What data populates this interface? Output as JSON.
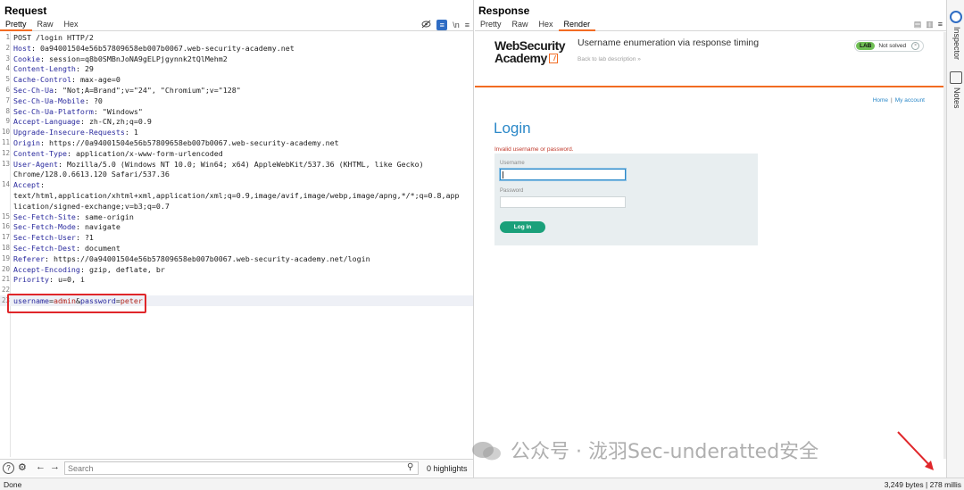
{
  "request": {
    "title": "Request",
    "tabs": [
      "Pretty",
      "Raw",
      "Hex"
    ],
    "lines": [
      {
        "n": "1",
        "k": "",
        "v": "POST /login HTTP/2"
      },
      {
        "n": "2",
        "k": "Host",
        "v": "0a94001504e56b57809658eb007b0067.web-security-academy.net"
      },
      {
        "n": "3",
        "k": "Cookie",
        "v": "session=q8b0SMBnJoNA9gELPjgynnk2tQlMehm2"
      },
      {
        "n": "4",
        "k": "Content-Length",
        "v": "29"
      },
      {
        "n": "5",
        "k": "Cache-Control",
        "v": "max-age=0"
      },
      {
        "n": "6",
        "k": "Sec-Ch-Ua",
        "v": "\"Not;A=Brand\";v=\"24\", \"Chromium\";v=\"128\""
      },
      {
        "n": "7",
        "k": "Sec-Ch-Ua-Mobile",
        "v": "?0"
      },
      {
        "n": "8",
        "k": "Sec-Ch-Ua-Platform",
        "v": "\"Windows\""
      },
      {
        "n": "9",
        "k": "Accept-Language",
        "v": "zh-CN,zh;q=0.9"
      },
      {
        "n": "10",
        "k": "Upgrade-Insecure-Requests",
        "v": "1"
      },
      {
        "n": "11",
        "k": "Origin",
        "v": "https://0a94001504e56b57809658eb007b0067.web-security-academy.net"
      },
      {
        "n": "12",
        "k": "Content-Type",
        "v": "application/x-www-form-urlencoded"
      },
      {
        "n": "13",
        "k": "User-Agent",
        "v": "Mozilla/5.0 (Windows NT 10.0; Win64; x64) AppleWebKit/537.36 (KHTML, like Gecko)"
      },
      {
        "n": "",
        "k": "",
        "v": "Chrome/128.0.6613.120 Safari/537.36"
      },
      {
        "n": "14",
        "k": "Accept",
        "v": ""
      },
      {
        "n": "",
        "k": "",
        "v": "text/html,application/xhtml+xml,application/xml;q=0.9,image/avif,image/webp,image/apng,*/*;q=0.8,app"
      },
      {
        "n": "",
        "k": "",
        "v": "lication/signed-exchange;v=b3;q=0.7"
      },
      {
        "n": "15",
        "k": "Sec-Fetch-Site",
        "v": "same-origin"
      },
      {
        "n": "16",
        "k": "Sec-Fetch-Mode",
        "v": "navigate"
      },
      {
        "n": "17",
        "k": "Sec-Fetch-User",
        "v": "?1"
      },
      {
        "n": "18",
        "k": "Sec-Fetch-Dest",
        "v": "document"
      },
      {
        "n": "19",
        "k": "Referer",
        "v": "https://0a94001504e56b57809658eb007b0067.web-security-academy.net/login"
      },
      {
        "n": "20",
        "k": "Accept-Encoding",
        "v": "gzip, deflate, br"
      },
      {
        "n": "21",
        "k": "Priority",
        "v": "u=0, i"
      },
      {
        "n": "22",
        "k": "",
        "v": ""
      }
    ],
    "body_line": {
      "n": "23",
      "k1": "username",
      "eq1": "=",
      "v1": "admin",
      "amp": "&",
      "k2": "password",
      "eq2": "=",
      "v2": "peter"
    },
    "toolbar_icons": [
      "hide-icon",
      "pretty-print-icon",
      "newline-icon",
      "menu-icon"
    ],
    "newline_label": "\\n",
    "search": {
      "placeholder": "Search",
      "highlights": "0 highlights"
    }
  },
  "response": {
    "title": "Response",
    "tabs": [
      "Pretty",
      "Raw",
      "Hex",
      "Render"
    ],
    "render": {
      "logo_line1": "WebSecurity",
      "logo_line2": "Academy",
      "lab_title": "Username enumeration via response timing",
      "back_link": "Back to lab description",
      "lab_badge": "LAB",
      "lab_status": "Not solved",
      "nav_home": "Home",
      "nav_sep": "|",
      "nav_account": "My account",
      "heading": "Login",
      "error": "Invalid username or password.",
      "username_label": "Username",
      "password_label": "Password",
      "login_button": "Log in"
    }
  },
  "rail": {
    "inspector": "Inspector",
    "notes": "Notes"
  },
  "status": {
    "left": "Done",
    "right": "3,249 bytes | 278 millis"
  },
  "watermark": "公众号 · 泷羽Sec-underatted安全",
  "colors": {
    "accent": "#f26b22",
    "link": "#2b88c8",
    "button": "#1aa07a",
    "highlight_box": "#e0262a",
    "error": "#c0392b"
  }
}
